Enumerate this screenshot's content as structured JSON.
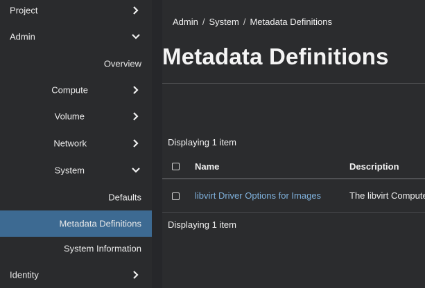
{
  "sidebar": {
    "items": [
      {
        "label": "Project"
      },
      {
        "label": "Admin"
      },
      {
        "label": "Overview"
      },
      {
        "label": "Compute"
      },
      {
        "label": "Volume"
      },
      {
        "label": "Network"
      },
      {
        "label": "System"
      },
      {
        "label": "Defaults"
      },
      {
        "label": "Metadata Definitions"
      },
      {
        "label": "System Information"
      },
      {
        "label": "Identity"
      }
    ]
  },
  "breadcrumb": {
    "items": [
      "Admin",
      "System",
      "Metadata Definitions"
    ],
    "separator": "/"
  },
  "page": {
    "title": "Metadata Definitions"
  },
  "table": {
    "count_top": "Displaying 1 item",
    "count_bottom": "Displaying 1 item",
    "columns": [
      "Name",
      "Description"
    ],
    "rows": [
      {
        "name": "libvirt Driver Options for Images",
        "description": "The libvirt Compute"
      }
    ]
  },
  "colors": {
    "accent": "#3d6a92",
    "link": "#7fb1dc",
    "background": "#2b2c2e"
  }
}
